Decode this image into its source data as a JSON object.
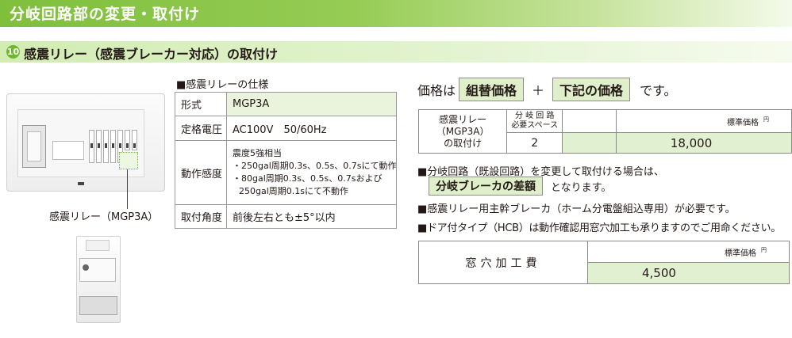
{
  "header": {
    "title": "分岐回路部の変更・取付け"
  },
  "section": {
    "number": "10",
    "title": "感震リレー（感震ブレーカー対応）の取付け"
  },
  "illustration": {
    "relay_label": "感震リレー（MGP3A）"
  },
  "spec": {
    "title": "■感震リレーの仕様",
    "rows": [
      {
        "key": "形式",
        "value": "MGP3A"
      },
      {
        "key": "定格電圧",
        "value": "AC100V　50/60Hz"
      },
      {
        "key": "動作感度",
        "lines": [
          "震度5強相当",
          "・250gal周期0.3s、0.5s、0.7sにて動作",
          "・80gal周期0.3s、0.5s、0.7sおよび",
          "250gal周期0.1sにて不動作"
        ]
      },
      {
        "key": "取付角度",
        "value": "前後左右とも±5°以内"
      }
    ]
  },
  "price_line": {
    "prefix": "価格は",
    "box1": "組替価格",
    "plus": "＋",
    "box2": "下記の価格",
    "suffix": "です。"
  },
  "table1": {
    "name_lines": [
      "感震リレー",
      "（MGP3A）",
      "の取付け"
    ],
    "space_header_lines": [
      "分 岐 回 路",
      "必要スペース"
    ],
    "space_value": "2",
    "price_label": "標準価格",
    "unit": "円",
    "price": "18,000"
  },
  "notes": {
    "n1": "■分岐回路（既設回路）を変更して取付ける場合は、",
    "n1_box": "分岐ブレーカの差額",
    "n1_tail": "となります。",
    "n2": "■感震リレー用主幹ブレーカ（ホーム分電盤組込専用）が必要です。",
    "n3": "■ドア付タイプ（HCB）は動作確認用窓穴加工も承りますのでご用命ください。"
  },
  "table2": {
    "name": "窓穴加工費",
    "price_label": "標準価格",
    "unit": "円",
    "price": "4,500"
  },
  "colors": {
    "header_green": "#7fbf3c",
    "section_green": "#d2ecb3",
    "box_green": "#dfefc9",
    "cell_green": "#e2f0d2"
  }
}
